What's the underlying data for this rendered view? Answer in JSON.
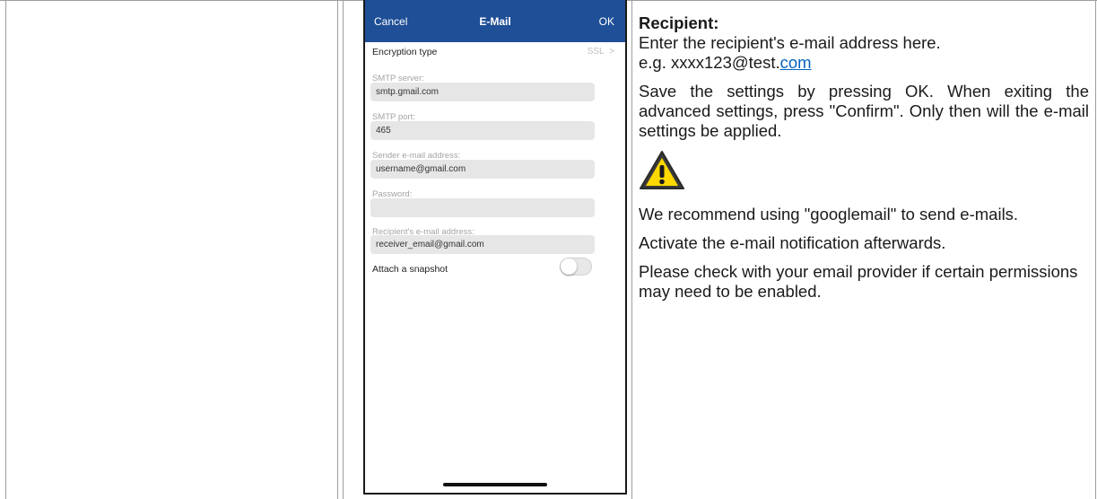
{
  "phone": {
    "header": {
      "cancel": "Cancel",
      "title": "E-Mail",
      "ok": "OK"
    },
    "encryption": {
      "label": "Encryption type",
      "value": "SSL",
      "chevron": ">"
    },
    "fields": [
      {
        "label": "SMTP server:",
        "value": "smtp.gmail.com"
      },
      {
        "label": "SMTP port:",
        "value": "465"
      },
      {
        "label": "Sender e-mail address:",
        "value": "username@gmail.com"
      },
      {
        "label": "Password:",
        "value": ""
      },
      {
        "label": "Recipient's e-mail address:",
        "value": "receiver_email@gmail.com"
      }
    ],
    "attach": {
      "label": "Attach a snapshot",
      "enabled": false
    }
  },
  "doc": {
    "heading": "Recipient:",
    "line1": "Enter the recipient's e-mail address here.",
    "example_prefix": "e.g. xxxx123@test.",
    "example_link": "com",
    "p2": "Save the settings by pressing OK. When exiting the advanced settings, press \"Confirm\". Only then will the e-mail settings be applied.",
    "p3": "We recommend using \"googlemail\" to send e-mails.",
    "p4": "Activate the e-mail notification afterwards.",
    "p5": "Please check with your email provider if certain permissions may need to be enabled."
  },
  "colors": {
    "header": "#1f4f96",
    "field": "#e6e6e6",
    "link": "#0563c1",
    "warning": "#ffd800"
  },
  "icons": {
    "warning": "warning-triangle-icon"
  }
}
